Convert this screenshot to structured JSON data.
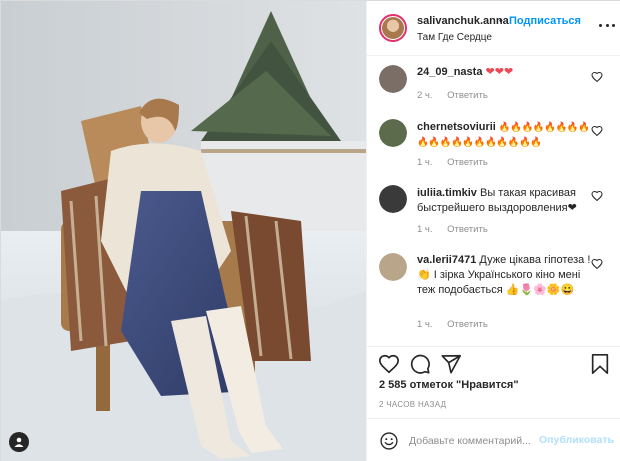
{
  "header": {
    "username": "salivanchuk.anna",
    "dot": "•",
    "follow_label": "Подписаться",
    "location": "Там Где Сердце",
    "avatar_icon": "avatar-photo",
    "more_icon": "more-options-icon"
  },
  "comments": [
    {
      "user": "24_09_nasta",
      "text": "❤❤❤",
      "time": "2 ч.",
      "reply": "Ответить",
      "avatar_color": "#7a6e66"
    },
    {
      "user": "chernetsoviurii",
      "text": "🔥🔥🔥🔥🔥🔥🔥🔥🔥🔥🔥🔥🔥🔥🔥🔥🔥🔥🔥",
      "time": "1 ч.",
      "reply": "Ответить",
      "avatar_color": "#5b6b4c"
    },
    {
      "user": "iuliia.timkiv",
      "text": "Вы такая красивая быстрейшего выздоровления❤",
      "time": "1 ч.",
      "reply": "Ответить",
      "avatar_color": "#3a3a3a"
    },
    {
      "user": "va.lerii7471",
      "text": "Дуже цікава гіпотеза ! 👏 І зірка Українського кіно мені теж подобається 👍🌷🌸🌼😀",
      "time": "1 ч.",
      "reply": "Ответить",
      "avatar_color": "#b9a58a"
    }
  ],
  "actions": {
    "like_icon": "heart-icon",
    "comment_icon": "comment-icon",
    "share_icon": "send-icon",
    "save_icon": "bookmark-icon",
    "likes_text": "2 585 отметок \"Нравится\"",
    "time_ago": "2 ЧАСОВ НАЗАД"
  },
  "add_comment": {
    "placeholder": "Добавьте комментарий...",
    "publish_label": "Опубликовать",
    "emoji_icon": "emoji-icon"
  },
  "photo": {
    "user_tag_icon": "user-tag-icon"
  },
  "colors": {
    "accent": "#0095f6",
    "publish_disabled": "#b2dffc",
    "text": "#262626",
    "muted": "#8e8e8e",
    "like_red": "#ed4956"
  }
}
